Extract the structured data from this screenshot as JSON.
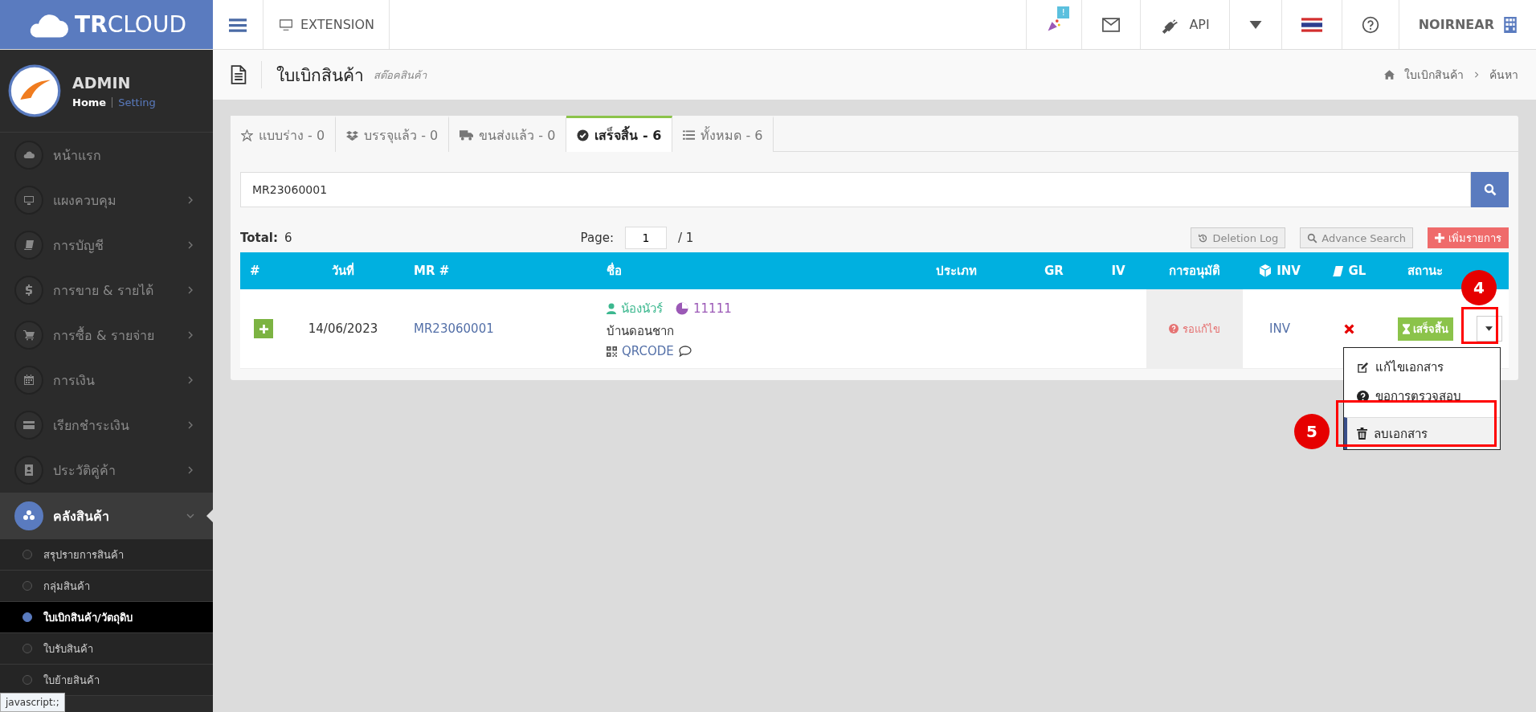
{
  "header": {
    "logo": "**TR**CLOUD",
    "extension": "EXTENSION",
    "notification_badge": "!",
    "api": "API",
    "user": "NOIRNEAR"
  },
  "sidebar": {
    "profile": {
      "name": "ADMIN",
      "links": [
        {
          "label": "Home",
          "selected": true
        },
        {
          "label": "Setting",
          "selected": false
        }
      ]
    },
    "items": [
      {
        "label": "หน้าแรก",
        "expandable": false,
        "expanded": false
      },
      {
        "label": "แผงควบคุม",
        "expandable": true,
        "expanded": false
      },
      {
        "label": "การบัญชี",
        "expandable": true,
        "expanded": false
      },
      {
        "label": "การขาย & รายได้",
        "expandable": true,
        "expanded": false
      },
      {
        "label": "การซื้อ & รายจ่าย",
        "expandable": true,
        "expanded": false
      },
      {
        "label": "การเงิน",
        "expandable": true,
        "expanded": false
      },
      {
        "label": "เรียกชำระเงิน",
        "expandable": true,
        "expanded": false
      },
      {
        "label": "ประวัติคู่ค้า",
        "expandable": true,
        "expanded": false
      },
      {
        "label": "คลังสินค้า",
        "expandable": true,
        "expanded": true,
        "children": [
          {
            "label": "สรุปรายการสินค้า",
            "selected": false
          },
          {
            "label": "กลุ่มสินค้า",
            "selected": false
          },
          {
            "label": "ใบเบิกสินค้า/วัตถุดิบ",
            "selected": true
          },
          {
            "label": "ใบรับสินค้า",
            "selected": false
          },
          {
            "label": "ใบย้ายสินค้า",
            "selected": false
          }
        ]
      }
    ]
  },
  "page": {
    "title": "ใบเบิกสินค้า",
    "subtitle": "สต๊อคสินค้า",
    "breadcrumb": [
      "ใบเบิกสินค้า",
      "ค้นหา"
    ]
  },
  "tabs": [
    {
      "label": "แบบร่าง - 0",
      "selected": false
    },
    {
      "label": "บรรจุแล้ว - 0",
      "selected": false
    },
    {
      "label": "ขนส่งแล้ว - 0",
      "selected": false
    },
    {
      "label": "เสร็จสิ้น - 6",
      "selected": true
    },
    {
      "label": "ทั้งหมด - 6",
      "selected": false
    }
  ],
  "search": {
    "value": "MR23060001"
  },
  "summary": {
    "total_label": "Total:",
    "total": "6",
    "page_label": "Page:",
    "page": "1",
    "page_count": "/ 1"
  },
  "buttons": [
    {
      "label": "Deletion Log",
      "kind": "history"
    },
    {
      "label": "Advance Search",
      "kind": "search"
    },
    {
      "label": "เพิ่มรายการ",
      "kind": "add"
    }
  ],
  "table": {
    "columns": [
      "#",
      "วันที่",
      "MR #",
      "ชื่อ",
      "ประเภท",
      "GR",
      "IV",
      "การอนุมัติ",
      "INV",
      "GL",
      "สถานะ"
    ],
    "rows": [
      {
        "date": "14/06/2023",
        "mr": "MR23060001",
        "contact": "น้องนัวร์",
        "points": "11111",
        "place": "บ้านดอนชาก",
        "qrcode": "QRCODE",
        "approval": "รอแก้ไข",
        "inv": "INV",
        "gl_posted": false,
        "status": "เสร็จสิ้น"
      }
    ]
  },
  "dropdown": {
    "items": [
      {
        "label": "แก้ไขเอกสาร",
        "kind": "edit",
        "selected": false
      },
      {
        "label": "ขอการตรวจสอบ",
        "kind": "help",
        "selected": false
      },
      {
        "label": "ลบเอกสาร",
        "kind": "delete",
        "selected": true
      }
    ]
  },
  "annotations": [
    "4",
    "5"
  ],
  "tooltip": "javascript:;"
}
